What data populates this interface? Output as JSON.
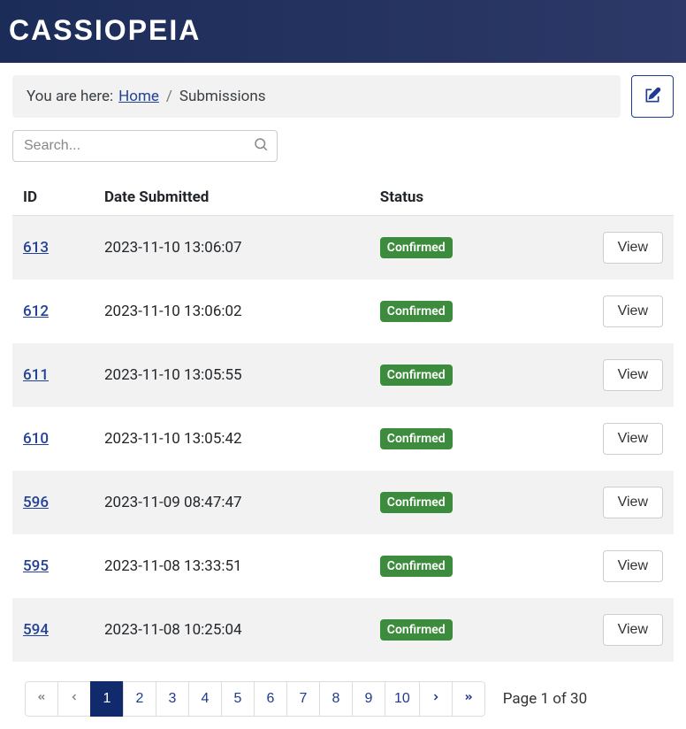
{
  "header": {
    "logo": "CASSIOPEIA"
  },
  "breadcrumb": {
    "prefix": "You are here:",
    "home": "Home",
    "current": "Submissions"
  },
  "search": {
    "placeholder": "Search..."
  },
  "table": {
    "headers": {
      "id": "ID",
      "date": "Date Submitted",
      "status": "Status",
      "action": ""
    },
    "rows": [
      {
        "id": "613",
        "date": "2023-11-10 13:06:07",
        "status": "Confirmed",
        "action": "View"
      },
      {
        "id": "612",
        "date": "2023-11-10 13:06:02",
        "status": "Confirmed",
        "action": "View"
      },
      {
        "id": "611",
        "date": "2023-11-10 13:05:55",
        "status": "Confirmed",
        "action": "View"
      },
      {
        "id": "610",
        "date": "2023-11-10 13:05:42",
        "status": "Confirmed",
        "action": "View"
      },
      {
        "id": "596",
        "date": "2023-11-09 08:47:47",
        "status": "Confirmed",
        "action": "View"
      },
      {
        "id": "595",
        "date": "2023-11-08 13:33:51",
        "status": "Confirmed",
        "action": "View"
      },
      {
        "id": "594",
        "date": "2023-11-08 10:25:04",
        "status": "Confirmed",
        "action": "View"
      }
    ]
  },
  "pagination": {
    "pages": [
      "1",
      "2",
      "3",
      "4",
      "5",
      "6",
      "7",
      "8",
      "9",
      "10"
    ],
    "active": "1",
    "info": "Page 1 of 30"
  }
}
